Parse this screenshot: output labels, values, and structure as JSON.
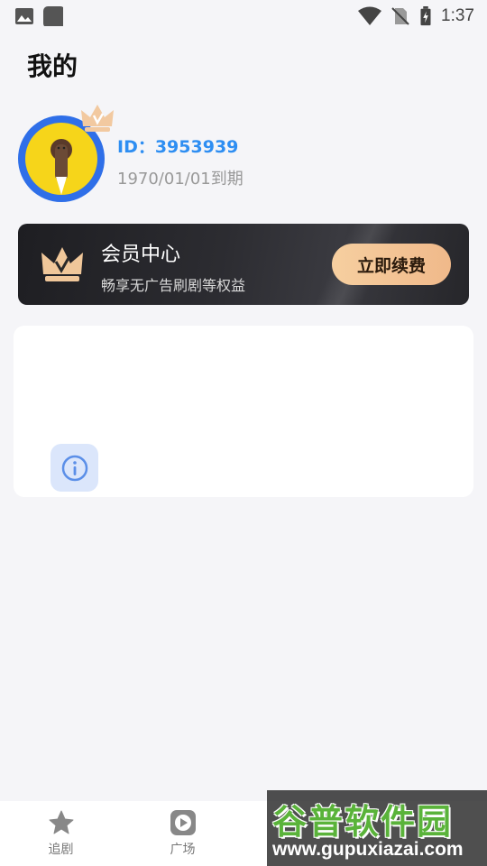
{
  "status_bar": {
    "time": "1:37",
    "icons": [
      "image-icon",
      "app-square-icon",
      "wifi-icon",
      "no-sim-icon",
      "battery-charging-icon"
    ]
  },
  "header": {
    "title": "我的"
  },
  "profile": {
    "id_text": "ID：3953939",
    "expiry": "1970/01/01到期",
    "avatar_icon": "avatar-image",
    "badge_icon": "crown-badge-icon"
  },
  "vip_card": {
    "title": "会员中心",
    "description": "畅享无广告刷剧等权益",
    "button_label": "立即续费",
    "icon": "vip-crown-icon"
  },
  "panel": {
    "icon": "info-icon"
  },
  "bottom_nav": {
    "items": [
      {
        "label": "追剧",
        "icon": "star-icon"
      },
      {
        "label": "广场",
        "icon": "play-icon"
      }
    ]
  },
  "watermark": {
    "logo": "谷普软件园",
    "url": "www.gupuxiazai.com"
  },
  "colors": {
    "accent_blue": "#2e8ef2",
    "vip_button": "#f0b98a",
    "background": "#f5f5f8"
  }
}
